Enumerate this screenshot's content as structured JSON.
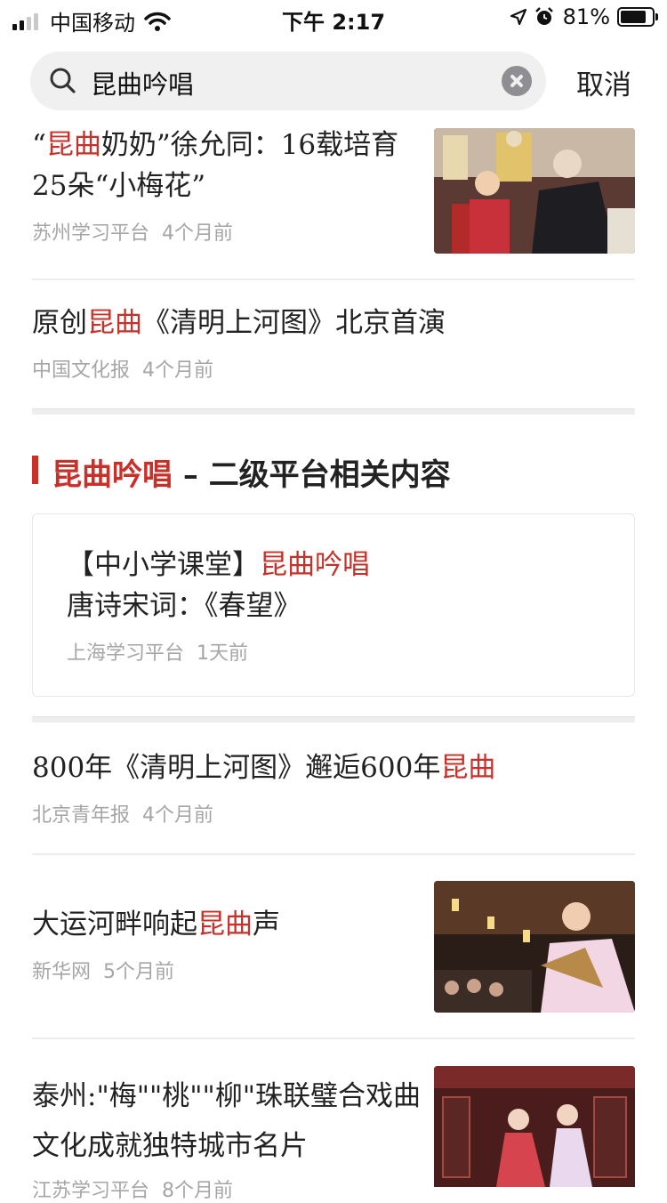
{
  "status_bar": {
    "carrier": "中国移动",
    "time": "下午 2:17",
    "battery": "81%",
    "battery_level": 0.81
  },
  "search": {
    "query": "昆曲吟唱",
    "cancel_label": "取消"
  },
  "results_top": [
    {
      "title_parts": [
        "“",
        "昆曲",
        "奶奶”徐允同：16载培育25朵“小梅花”"
      ],
      "source": "苏州学习平台",
      "age": "4个月前"
    },
    {
      "title_parts": [
        "原创",
        "昆曲",
        "《清明上河图》北京首演"
      ],
      "source": "中国文化报",
      "age": "4个月前"
    }
  ],
  "section": {
    "keyword": "昆曲吟唱",
    "dash": " – ",
    "label": "二级平台相关内容",
    "card": {
      "title_parts": [
        "【中小学课堂】",
        "昆曲吟唱",
        "唐诗宋词：《春望》"
      ],
      "source": "上海学习平台",
      "age": "1天前"
    }
  },
  "results_bottom": [
    {
      "title_parts": [
        "800年《清明上河图》邂逅600年",
        "昆曲",
        ""
      ],
      "source": "北京青年报",
      "age": "4个月前"
    },
    {
      "title_parts": [
        "大运河畔响起",
        "昆曲",
        "声"
      ],
      "source": "新华网",
      "age": "5个月前"
    },
    {
      "title_parts": [
        "泰州:\"梅\"\"桃\"\"柳\"珠联璧合戏曲文化成就独特城市名片",
        "",
        ""
      ],
      "source": "江苏学习平台",
      "age": "8个月前"
    }
  ],
  "colors": {
    "highlight": "#c8302a",
    "meta": "#a6a6a6"
  },
  "icons": [
    "signal-icon",
    "wifi-icon",
    "location-icon",
    "alarm-icon",
    "battery-icon",
    "search-icon",
    "clear-icon"
  ]
}
